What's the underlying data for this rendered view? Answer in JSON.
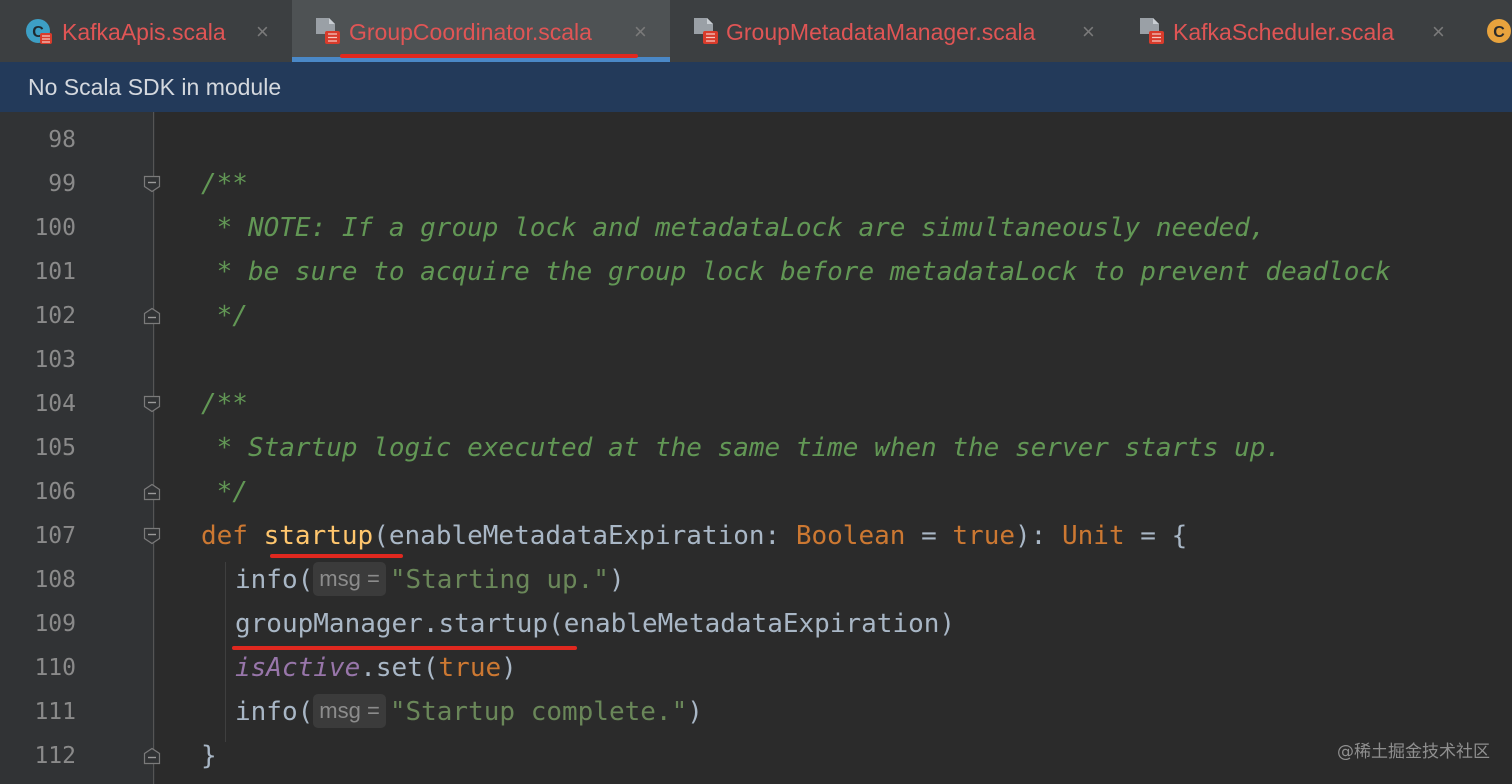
{
  "tabs": [
    {
      "label": "KafkaApis.scala",
      "icon": "scala-class-icon",
      "active": false
    },
    {
      "label": "GroupCoordinator.scala",
      "icon": "scala-file-icon",
      "active": true
    },
    {
      "label": "GroupMetadataManager.scala",
      "icon": "scala-file-icon",
      "active": false
    },
    {
      "label": "KafkaScheduler.scala",
      "icon": "scala-file-icon",
      "active": false
    },
    {
      "label": "",
      "icon": "scala-class-icon",
      "active": false
    }
  ],
  "tab_close_glyph": "×",
  "banner": {
    "text": "No Scala SDK in module"
  },
  "editor": {
    "line_numbers": [
      "98",
      "99",
      "100",
      "101",
      "102",
      "103",
      "104",
      "105",
      "106",
      "107",
      "108",
      "109",
      "110",
      "111",
      "112"
    ],
    "lines": {
      "l98": "",
      "l99": "/**",
      "l100": " * NOTE: If a group lock and metadataLock are simultaneously needed,",
      "l101": " * be sure to acquire the group lock before metadataLock to prevent deadlock",
      "l102": " */",
      "l103": "",
      "l104": "/**",
      "l105": " * Startup logic executed at the same time when the server starts up.",
      "l106": " */",
      "l107": {
        "kw_def": "def ",
        "fn_name": "startup",
        "open": "(enableMetadataExpiration: ",
        "type_bool": "Boolean",
        "eq": " = ",
        "kw_true": "true",
        "close": "): ",
        "type_unit": "Unit",
        "tail": " = {"
      },
      "l108": {
        "call": "info(",
        "hint": "msg =",
        "str": "\"Starting up.\"",
        "close": ")"
      },
      "l109": {
        "text": "groupManager.startup(enableMetadataExpiration)"
      },
      "l110": {
        "field": "isActive",
        "mid": ".set(",
        "kw_true": "true",
        "close": ")"
      },
      "l111": {
        "call": "info(",
        "hint": "msg =",
        "str": "\"Startup complete.\"",
        "close": ")"
      },
      "l112": "}"
    }
  },
  "watermark": "@稀土掘金技术社区",
  "colors": {
    "comment": "#629755",
    "keyword": "#cc7832",
    "function": "#ffc66d",
    "string": "#6a8759",
    "field": "#9876aa",
    "tab_label": "#e05555",
    "annotation_underline": "#e0281f",
    "banner_bg": "#233a5a"
  }
}
